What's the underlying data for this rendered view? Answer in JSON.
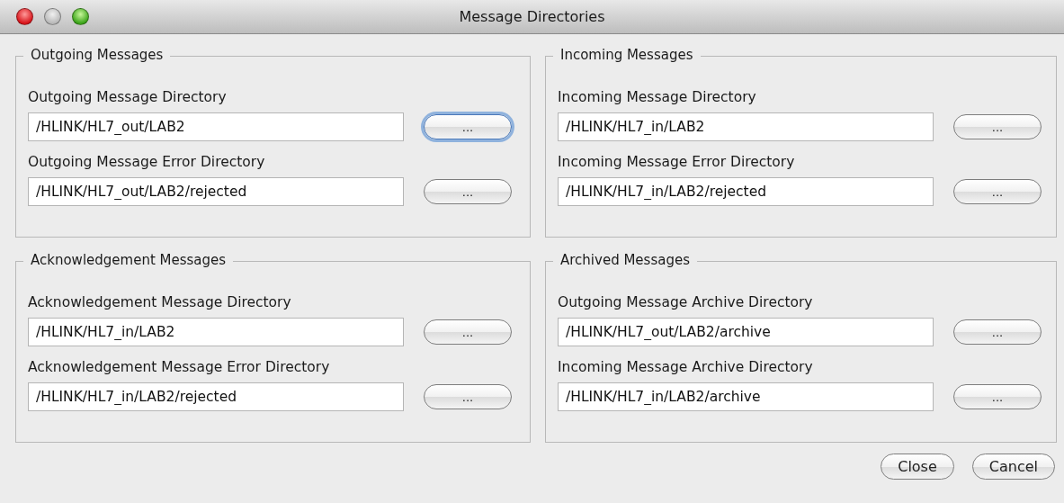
{
  "window": {
    "title": "Message Directories"
  },
  "groups": [
    {
      "title": "Outgoing Messages",
      "fields": [
        {
          "label": "Outgoing Message Directory",
          "value": "/HLINK/HL7_out/LAB2",
          "button": "...",
          "focused": true
        },
        {
          "label": "Outgoing Message Error Directory",
          "value": "/HLINK/HL7_out/LAB2/rejected",
          "button": "...",
          "focused": false
        }
      ]
    },
    {
      "title": "Incoming Messages",
      "fields": [
        {
          "label": "Incoming Message Directory",
          "value": "/HLINK/HL7_in/LAB2",
          "button": "...",
          "focused": false
        },
        {
          "label": "Incoming Message Error Directory",
          "value": "/HLINK/HL7_in/LAB2/rejected",
          "button": "...",
          "focused": false
        }
      ]
    },
    {
      "title": "Acknowledgement Messages",
      "fields": [
        {
          "label": "Acknowledgement Message Directory",
          "value": "/HLINK/HL7_in/LAB2",
          "button": "...",
          "focused": false
        },
        {
          "label": "Acknowledgement Message Error Directory",
          "value": "/HLINK/HL7_in/LAB2/rejected",
          "button": "...",
          "focused": false
        }
      ]
    },
    {
      "title": "Archived Messages",
      "fields": [
        {
          "label": "Outgoing Message Archive Directory",
          "value": "/HLINK/HL7_out/LAB2/archive",
          "button": "...",
          "focused": false
        },
        {
          "label": "Incoming Message Archive Directory",
          "value": "/HLINK/HL7_in/LAB2/archive",
          "button": "...",
          "focused": false
        }
      ]
    }
  ],
  "buttons": [
    "Close",
    "Cancel"
  ]
}
